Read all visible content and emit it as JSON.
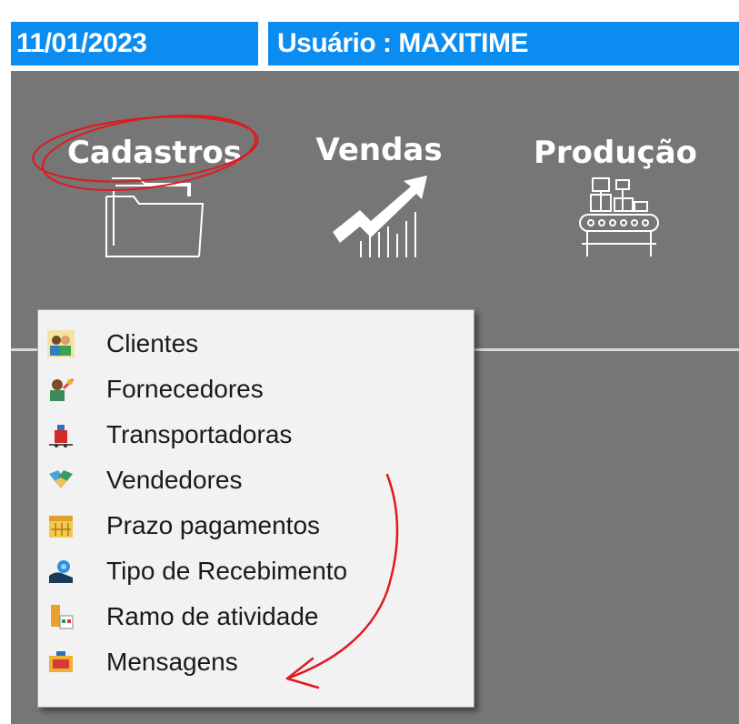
{
  "status_bar": {
    "date": "11/01/2023",
    "user": "Usuário : MAXITIME"
  },
  "modules": [
    {
      "label": "Cadastros",
      "icon": "folder-icon"
    },
    {
      "label": "Vendas",
      "icon": "sales-chart-icon"
    },
    {
      "label": "Produção",
      "icon": "production-line-icon"
    }
  ],
  "cadastros_menu": {
    "items": [
      {
        "label": "Clientes",
        "icon": "clients-icon"
      },
      {
        "label": "Fornecedores",
        "icon": "suppliers-icon"
      },
      {
        "label": "Transportadoras",
        "icon": "carriers-icon"
      },
      {
        "label": "Vendedores",
        "icon": "sellers-icon"
      },
      {
        "label": "Prazo pagamentos",
        "icon": "calendar-icon"
      },
      {
        "label": "Tipo de Recebimento",
        "icon": "receipt-type-icon"
      },
      {
        "label": "Ramo de atividade",
        "icon": "business-branch-icon"
      },
      {
        "label": "Mensagens",
        "icon": "messages-icon"
      }
    ]
  },
  "colors": {
    "status_bar_bg": "#0a8cf0",
    "background": "#767676",
    "menu_bg": "#f2f2f2",
    "annotation": "#e0191f"
  }
}
